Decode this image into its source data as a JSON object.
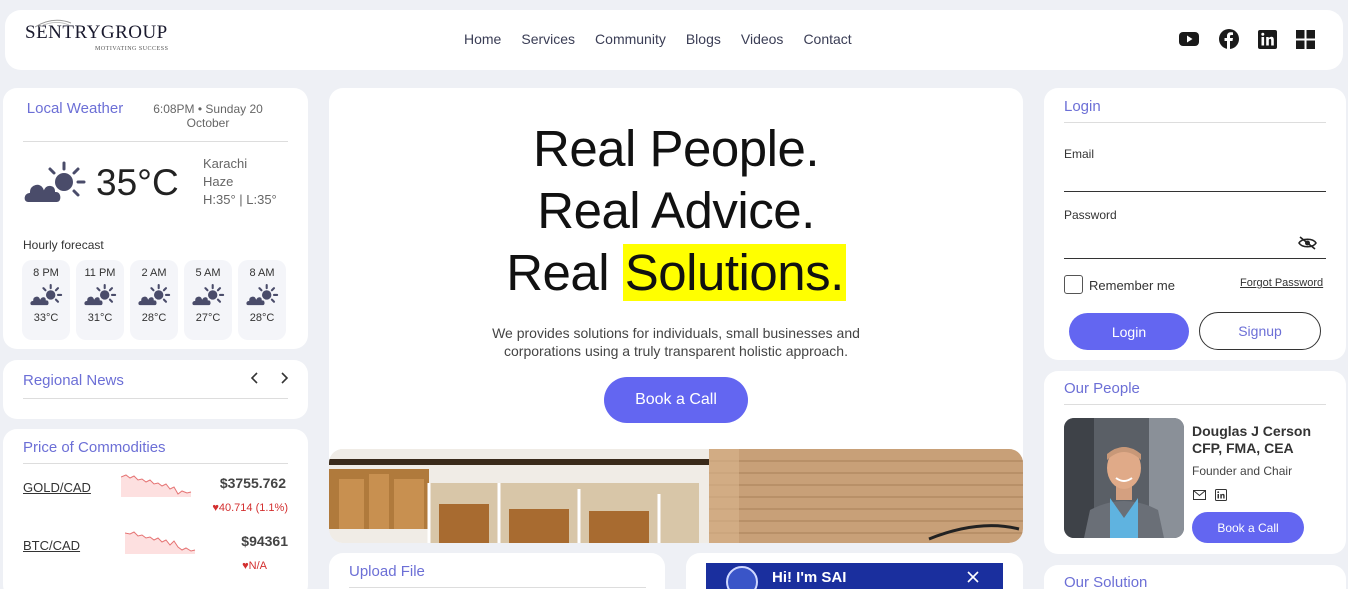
{
  "header": {
    "logo_text": "SENTRYGROUP",
    "logo_tagline": "MOTIVATING SUCCESS",
    "nav": [
      "Home",
      "Services",
      "Community",
      "Blogs",
      "Videos",
      "Contact"
    ],
    "social_icons": [
      "youtube-icon",
      "facebook-icon",
      "linkedin-icon",
      "grid-icon"
    ]
  },
  "weather": {
    "title": "Local Weather",
    "time": "6:08PM • Sunday 20 October",
    "temp": "35°C",
    "city": "Karachi",
    "condition": "Haze",
    "hilo": "H:35° | L:35°",
    "hourly_label": "Hourly forecast",
    "hourly": [
      {
        "time": "8 PM",
        "temp": "33°C"
      },
      {
        "time": "11 PM",
        "temp": "31°C"
      },
      {
        "time": "2 AM",
        "temp": "28°C"
      },
      {
        "time": "5 AM",
        "temp": "27°C"
      },
      {
        "time": "8 AM",
        "temp": "28°C"
      }
    ]
  },
  "news": {
    "title": "Regional News",
    "prev_icon": "chevron-left-icon",
    "next_icon": "chevron-right-icon"
  },
  "commodities": {
    "title": "Price of Commodities",
    "items": [
      {
        "name": "GOLD/CAD",
        "price": "$3755.762",
        "change": "♥40.714 (1.1%)"
      },
      {
        "name": "BTC/CAD",
        "price": "$94361",
        "change": "♥N/A"
      }
    ]
  },
  "hero": {
    "line1": "Real People.",
    "line2": "Real Advice.",
    "line3_prefix": "Real ",
    "line3_highlight": "Solutions.",
    "highlight_color": "#ffff00",
    "subtext": "We provides solutions for individuals, small businesses and corporations using a truly transparent holistic approach.",
    "cta": "Book a Call"
  },
  "upload": {
    "title": "Upload File"
  },
  "chat": {
    "title": "Hi! I'm SAI"
  },
  "login": {
    "title": "Login",
    "email_label": "Email",
    "password_label": "Password",
    "remember": "Remember me",
    "forgot": "Forgot Password",
    "login_btn": "Login",
    "signup_btn": "Signup"
  },
  "people": {
    "title": "Our People",
    "name": "Douglas J Cerson",
    "credentials": "CFP, FMA, CEA",
    "role": "Founder and Chair",
    "cta": "Book a Call"
  },
  "solution": {
    "title": "Our Solution"
  },
  "colors": {
    "accent": "#6c6fd6",
    "button": "#6366f1",
    "down": "#d32f2f"
  }
}
